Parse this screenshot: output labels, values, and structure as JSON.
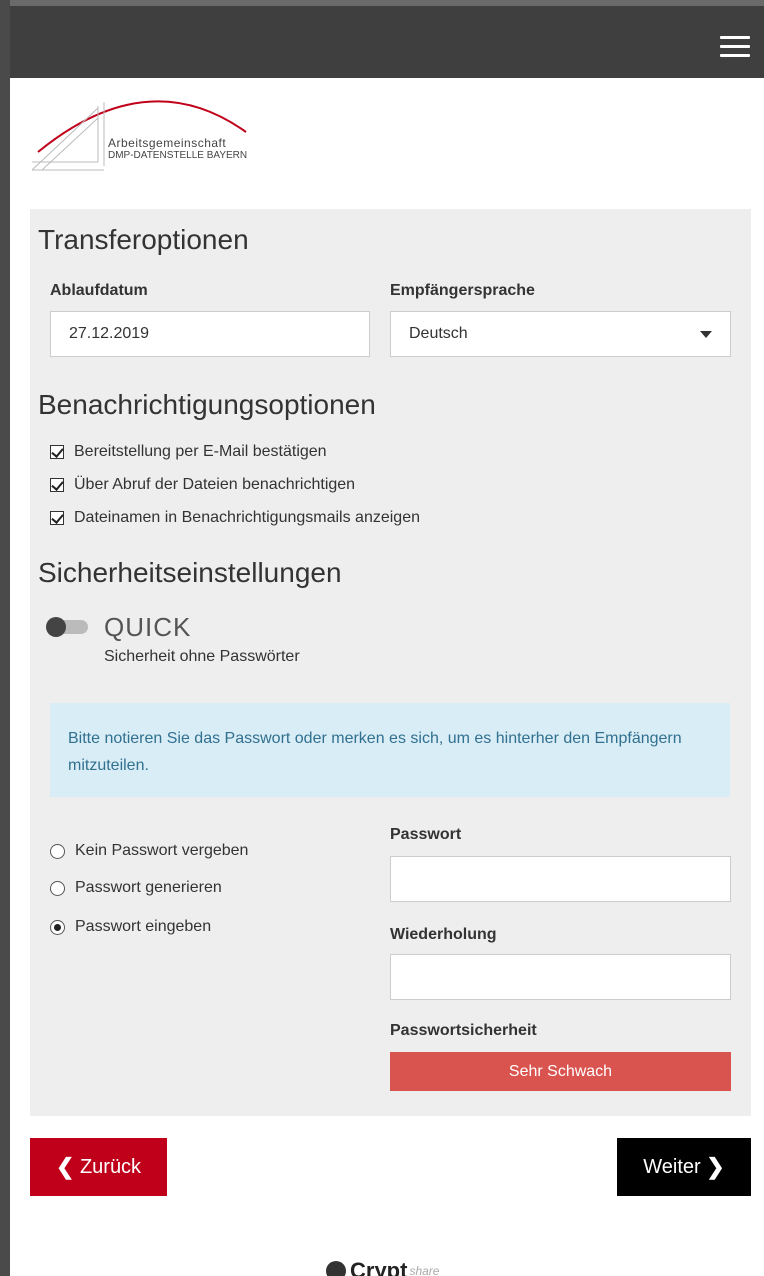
{
  "header": {
    "menu_icon": "hamburger-icon"
  },
  "logo": {
    "line1": "Arbeitsgemeinschaft",
    "line2": "DMP-DATENSTELLE BAYERN"
  },
  "transfer": {
    "title": "Transferoptionen",
    "expiry_label": "Ablaufdatum",
    "expiry_value": "27.12.2019",
    "language_label": "Empfängersprache",
    "language_value": "Deutsch"
  },
  "notifications": {
    "title": "Benachrichtigungsoptionen",
    "items": [
      {
        "label": "Bereitstellung per E-Mail bestätigen",
        "checked": true
      },
      {
        "label": "Über Abruf der Dateien benachrichtigen",
        "checked": true
      },
      {
        "label": "Dateinamen in Benachrichtigungsmails anzeigen",
        "checked": true
      }
    ]
  },
  "security": {
    "title": "Sicherheitseinstellungen",
    "mode_label": "QUICK",
    "mode_sub": "Sicherheit ohne Passwörter",
    "mode_enabled": false,
    "alert": "Bitte notieren Sie das Passwort oder merken es sich, um es hinterher den Empfängern mitzuteilen.",
    "options": [
      {
        "label": "Kein Passwort vergeben",
        "selected": false
      },
      {
        "label": "Passwort generieren",
        "selected": false
      },
      {
        "label": "Passwort eingeben",
        "selected": true
      }
    ],
    "password_label": "Passwort",
    "password_value": "",
    "repeat_label": "Wiederholung",
    "repeat_value": "",
    "strength_label": "Passwortsicherheit",
    "strength_value": "Sehr Schwach",
    "strength_color": "#d9534f"
  },
  "nav": {
    "back_label": "Zurück",
    "next_label": "Weiter"
  },
  "footer": {
    "brand_bold": "Crypt",
    "brand_light": "share"
  },
  "colors": {
    "back_button": "#c0001a",
    "next_button": "#000000",
    "topbar": "#3f3f3f",
    "alert_bg": "#d9edf7"
  }
}
